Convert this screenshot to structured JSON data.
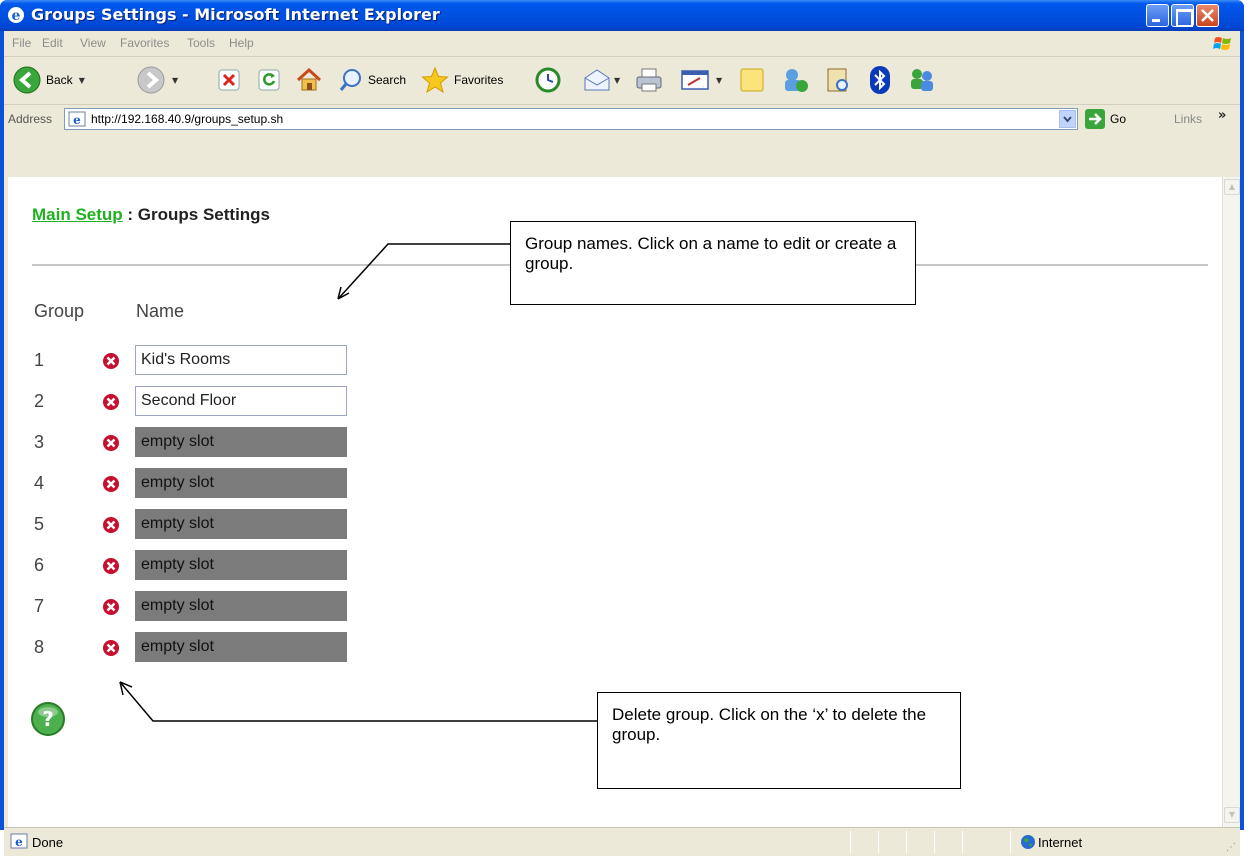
{
  "window": {
    "title": "Groups Settings - Microsoft Internet Explorer"
  },
  "menu": [
    "File",
    "Edit",
    "View",
    "Favorites",
    "Tools",
    "Help"
  ],
  "toolbar": {
    "back_label": "Back",
    "search_label": "Search",
    "favorites_label": "Favorites"
  },
  "address": {
    "label": "Address",
    "url": "http://192.168.40.9/groups_setup.sh",
    "go_label": "Go",
    "links_label": "Links"
  },
  "page": {
    "breadcrumb_link": "Main Setup",
    "breadcrumb_sep": " : ",
    "title": "Groups Settings",
    "col_group": "Group",
    "col_name": "Name",
    "groups": [
      {
        "num": "1",
        "name": "Kid's Rooms",
        "state": "filled"
      },
      {
        "num": "2",
        "name": "Second Floor",
        "state": "filled"
      },
      {
        "num": "3",
        "name": "empty slot",
        "state": "empty"
      },
      {
        "num": "4",
        "name": "empty slot",
        "state": "empty"
      },
      {
        "num": "5",
        "name": "empty slot",
        "state": "empty"
      },
      {
        "num": "6",
        "name": "empty slot",
        "state": "empty"
      },
      {
        "num": "7",
        "name": "empty slot",
        "state": "empty"
      },
      {
        "num": "8",
        "name": "empty slot",
        "state": "empty"
      }
    ]
  },
  "callouts": {
    "group_names": "Group names.  Click on a name to edit or create a group.",
    "delete_group": "Delete group.  Click on the ‘x’ to delete the group."
  },
  "status": {
    "text": "Done",
    "zone": "Internet"
  },
  "colors": {
    "link_green": "#20b020",
    "empty_slot": "#7b7b7b",
    "delete_red": "#c8102e",
    "xp_blue": "#0050e0"
  }
}
